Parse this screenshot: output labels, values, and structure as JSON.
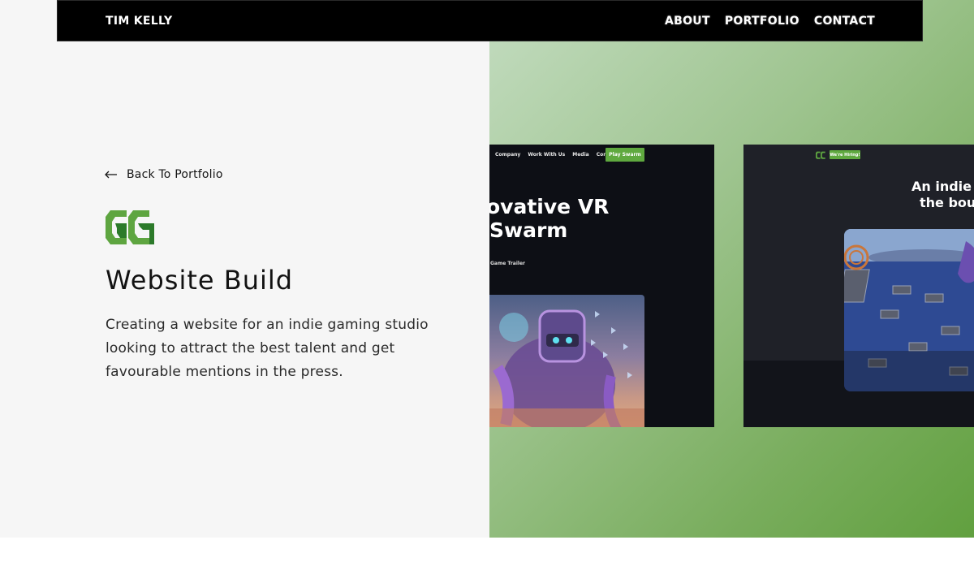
{
  "header": {
    "brand": "TIM KELLY",
    "links": [
      "ABOUT",
      "PORTFOLIO",
      "CONTACT"
    ]
  },
  "project": {
    "back_label": "Back To Portfolio",
    "title": "Website Build",
    "description": "Creating a website for an indie gaming studio looking to attract the best talent and get favourable mentions in the press."
  },
  "shot1": {
    "nav_items": [
      "Company",
      "Work With Us",
      "Media",
      "Contact"
    ],
    "play_button": "Play Swarm",
    "heading_line1": "ovative VR",
    "heading_line2": "Swarm",
    "trailer_label": "Game Trailer"
  },
  "shot2": {
    "hiring_button": "We're Hiring!",
    "heading_line1": "An indie s",
    "heading_line2": "the boun"
  },
  "colors": {
    "accent_green": "#5fa93f",
    "nav_bg": "#000000",
    "left_bg": "#f6f6f6",
    "text_dark": "#121212"
  },
  "icons": {
    "back": "arrow-left-icon",
    "logo": "studio-logo"
  }
}
